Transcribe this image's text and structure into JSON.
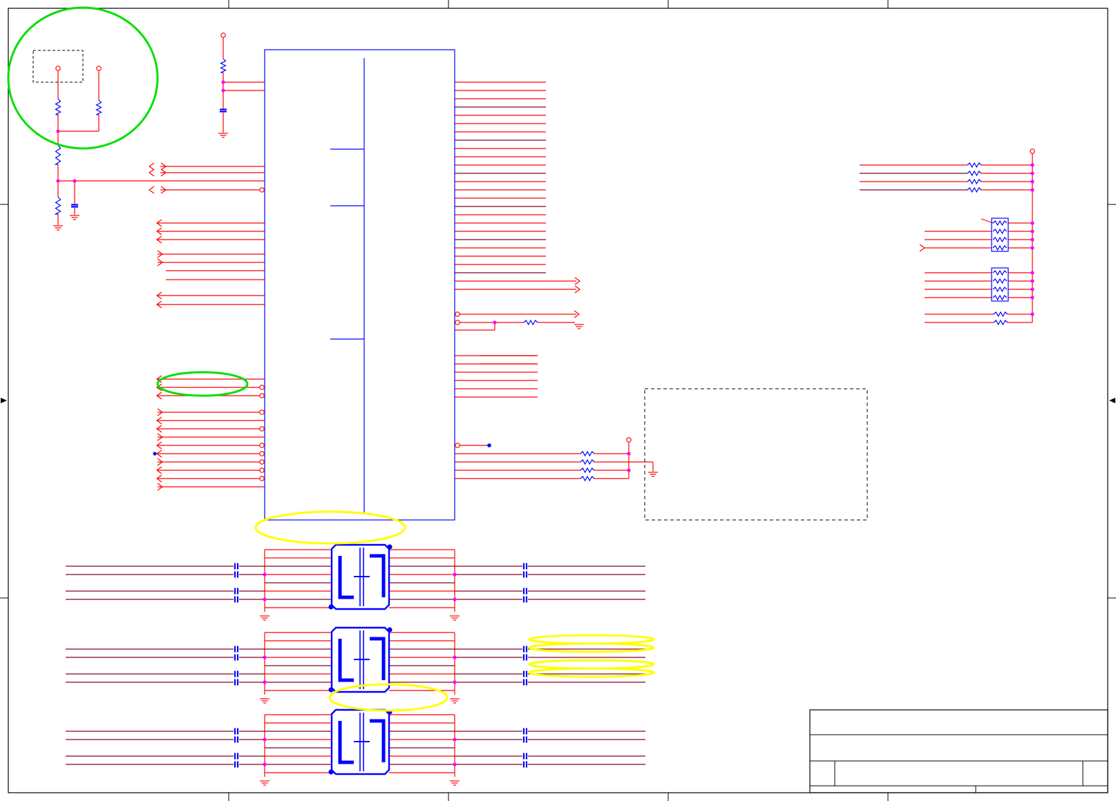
{
  "document": {
    "type": "schematic-sheet",
    "text_labels": []
  },
  "colors": {
    "wire": "#ff0000",
    "bus_wire": "#800020",
    "component": "#0000ff",
    "junction": "#ff00ff",
    "frame": "#000000",
    "marker_green": "#00e000",
    "marker_yellow": "#ffff00"
  }
}
